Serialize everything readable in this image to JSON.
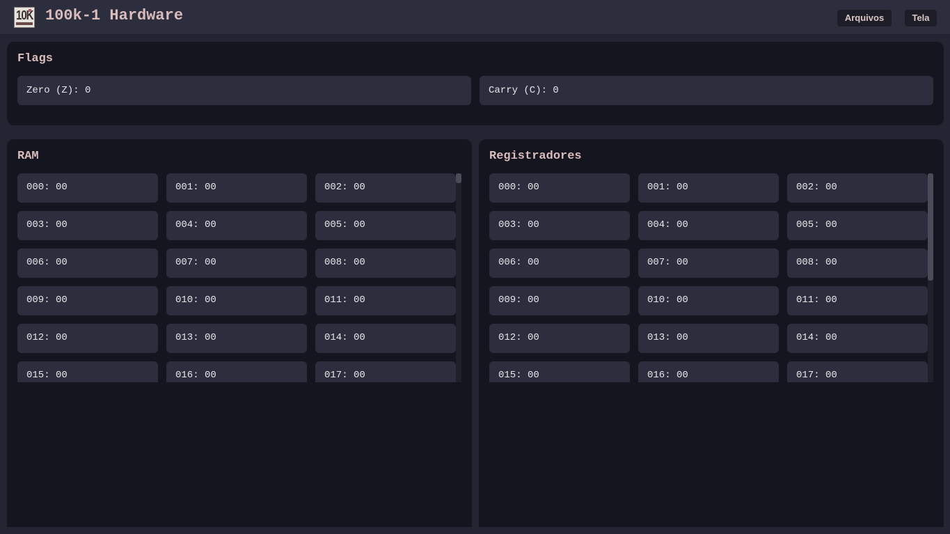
{
  "header": {
    "logo_text": "10K",
    "title": "100k-1 Hardware",
    "menu": [
      "Arquivos",
      "Tela"
    ]
  },
  "flags": {
    "title": "Flags",
    "zero": "Zero (Z): 0",
    "carry": "Carry (C): 0"
  },
  "ram": {
    "title": "RAM",
    "cells": [
      "000: 00",
      "001: 00",
      "002: 00",
      "003: 00",
      "004: 00",
      "005: 00",
      "006: 00",
      "007: 00",
      "008: 00",
      "009: 00",
      "010: 00",
      "011: 00",
      "012: 00",
      "013: 00",
      "014: 00",
      "015: 00",
      "016: 00",
      "017: 00"
    ]
  },
  "registers": {
    "title": "Registradores",
    "cells": [
      "000: 00",
      "001: 00",
      "002: 00",
      "003: 00",
      "004: 00",
      "005: 00",
      "006: 00",
      "007: 00",
      "008: 00",
      "009: 00",
      "010: 00",
      "011: 00",
      "012: 00",
      "013: 00",
      "014: 00",
      "015: 00",
      "016: 00",
      "017: 00"
    ]
  },
  "colors": {
    "background": "#242533",
    "panel": "#14151e",
    "cell": "#2d2e3d",
    "accent_text": "#d9bcbc",
    "value_text": "#e6e6ea"
  }
}
